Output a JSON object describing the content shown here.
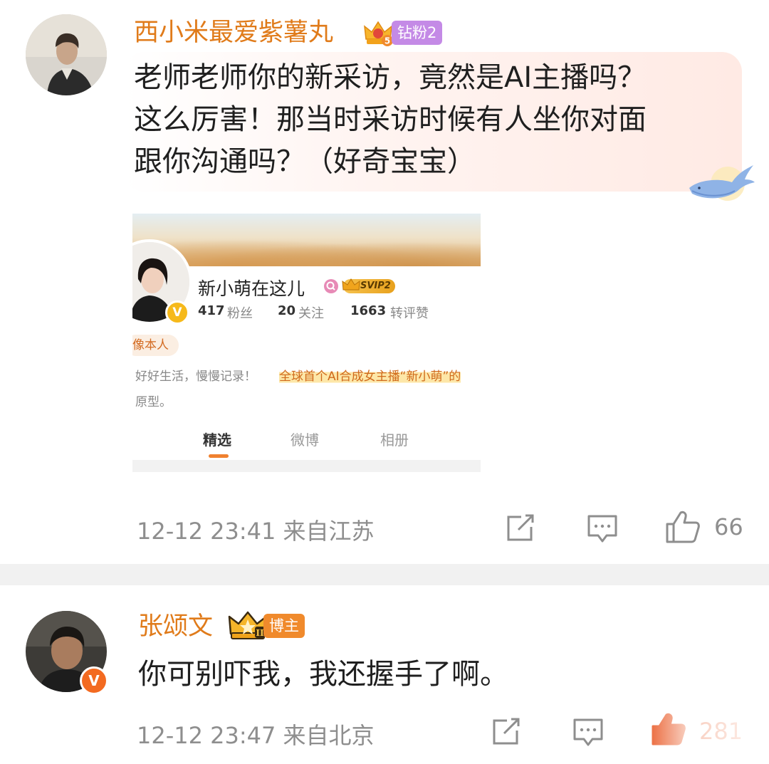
{
  "comments": [
    {
      "username": "西小米最爱紫薯丸",
      "badge_level": "5",
      "badge_label": "钻粉2",
      "text_lines": [
        "老师老师你的新采访，竟然是AI主播吗？",
        "这么厉害！那当时采访时候有人坐你对面",
        "跟你沟通吗？（好奇宝宝）"
      ],
      "timestamp_location": "12-12 23:41  来自江苏",
      "like_count": "66",
      "embedded_screenshot": {
        "name": "新小萌在这儿",
        "vip_badge": "SVIP2",
        "stats": [
          {
            "num": "417",
            "label": "粉丝"
          },
          {
            "num": "20",
            "label": "关注"
          },
          {
            "num": "1663",
            "label": "转评赞"
          }
        ],
        "tag": "像本人",
        "bio_plain": "好好生活，慢慢记录！",
        "bio_highlight": "全球首个AI合成女主播“新小萌”的",
        "bio_line2": "原型。",
        "tabs": [
          "精选",
          "微博",
          "相册"
        ],
        "active_tab": "精选"
      }
    },
    {
      "username": "张颂文",
      "badge_level": "II",
      "badge_label": "博主",
      "text_lines": [
        "你可别吓我，我还握手了啊。"
      ],
      "timestamp_location": "12-12 23:47  来自北京",
      "like_count": "281"
    }
  ],
  "colors": {
    "username": "#e07b1a",
    "meta": "#8e8e8e",
    "liked": "#e8541f",
    "diamond_badge": "#c48ae6",
    "blogger_badge": "#f08a2c"
  },
  "icons": [
    "share-icon",
    "comment-icon",
    "like-icon",
    "crown-icon",
    "whale-icon",
    "verified-v-icon"
  ]
}
